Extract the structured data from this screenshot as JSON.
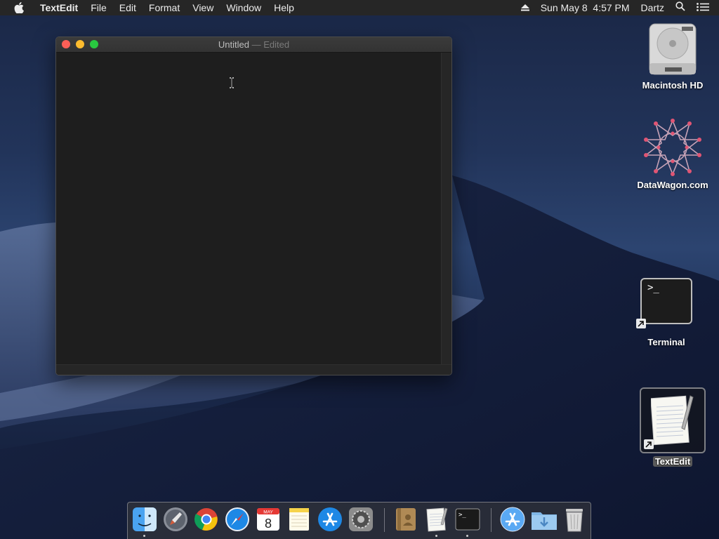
{
  "menubar": {
    "apple_icon": "apple-logo-icon",
    "app_name": "TextEdit",
    "menus": [
      "File",
      "Edit",
      "Format",
      "View",
      "Window",
      "Help"
    ],
    "eject_icon": "eject-icon",
    "datetime": "Sun May 8  4:57 PM",
    "user": "Dartz",
    "search_icon": "spotlight-search-icon",
    "notifications_icon": "notification-center-icon"
  },
  "window": {
    "title": "Untitled",
    "separator": "—",
    "status": "Edited",
    "content": ""
  },
  "desktop_icons": [
    {
      "label": "Macintosh HD",
      "icon": "hard-drive-icon"
    },
    {
      "label": "DataWagon.com",
      "icon": "datawagon-logo-icon"
    },
    {
      "label": "Terminal",
      "icon": "terminal-alias-icon",
      "glyph": ">_"
    },
    {
      "label": "TextEdit",
      "icon": "textedit-alias-icon",
      "selected": true
    }
  ],
  "dock": {
    "items": [
      {
        "name": "Finder",
        "icon": "finder-icon",
        "running": true
      },
      {
        "name": "Launchpad",
        "icon": "launchpad-icon",
        "running": false
      },
      {
        "name": "Google Chrome",
        "icon": "chrome-icon",
        "running": false
      },
      {
        "name": "Safari",
        "icon": "safari-icon",
        "running": false
      },
      {
        "name": "Calendar",
        "icon": "calendar-icon",
        "running": false,
        "month": "MAY",
        "day": "8"
      },
      {
        "name": "Notes",
        "icon": "notes-icon",
        "running": false
      },
      {
        "name": "App Store",
        "icon": "app-store-icon",
        "running": false
      },
      {
        "name": "System Preferences",
        "icon": "system-preferences-icon",
        "running": false
      },
      {
        "name": "Contacts",
        "icon": "contacts-icon",
        "running": false
      },
      {
        "name": "TextEdit",
        "icon": "textedit-icon",
        "running": true
      },
      {
        "name": "Terminal",
        "icon": "terminal-icon",
        "running": true,
        "glyph": ">_"
      },
      {
        "name": "Applications",
        "icon": "applications-folder-icon",
        "running": false
      },
      {
        "name": "Downloads",
        "icon": "downloads-folder-icon",
        "running": false
      },
      {
        "name": "Trash",
        "icon": "trash-icon",
        "running": false
      }
    ]
  }
}
